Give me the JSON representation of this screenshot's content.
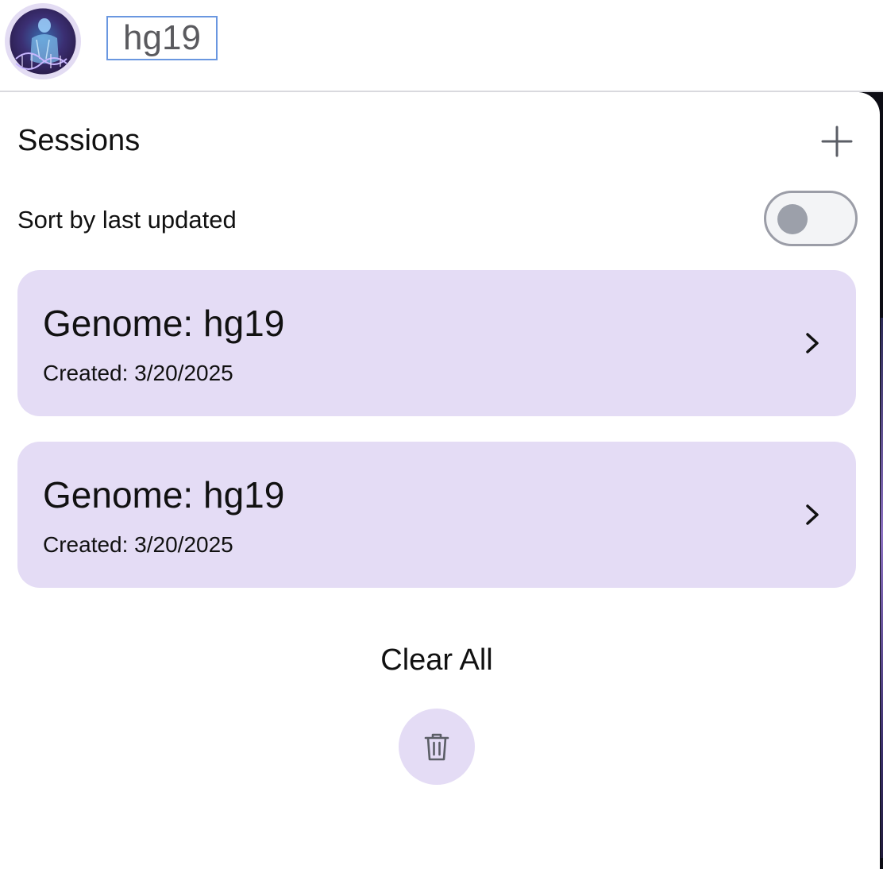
{
  "header": {
    "genome_label": "hg19"
  },
  "panel": {
    "title": "Sessions",
    "sort_label": "Sort by last updated",
    "sort_toggle_on": false,
    "sessions": [
      {
        "title": "Genome: hg19",
        "created": "Created: 3/20/2025"
      },
      {
        "title": "Genome: hg19",
        "created": "Created: 3/20/2025"
      }
    ],
    "clear_all_label": "Clear All"
  },
  "colors": {
    "card_bg": "#e4dcf5",
    "selection_border": "#6a97e0",
    "toggle_knob": "#9ca0aa"
  },
  "icons": {
    "add": "plus-icon",
    "chevron": "chevron-right-icon",
    "trash": "trash-icon",
    "avatar": "anatomy-dna-avatar"
  }
}
